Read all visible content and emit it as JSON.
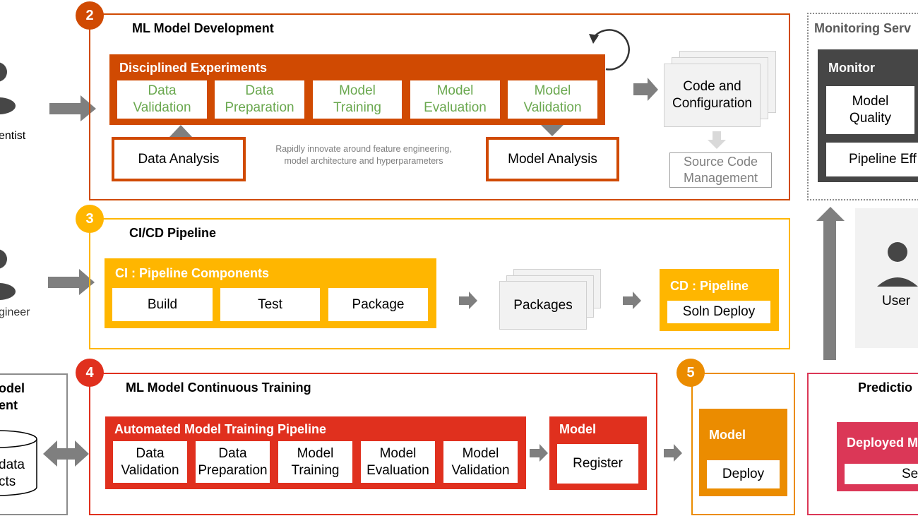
{
  "colors": {
    "dev": "#d04a02",
    "cicd": "#ffb600",
    "ct": "#e0301e",
    "deploy": "#eb8c00",
    "prediction": "#db3757",
    "monitor": "#464646",
    "arrow": "#7f7f7f",
    "green_text": "#6aa84f"
  },
  "left": {
    "data_scientist_label": "entist",
    "ml_engineer_label": "gineer",
    "model_mgmt_title_line1": "odel",
    "model_mgmt_title_line2": "ent",
    "cylinder_line1": "data",
    "cylinder_line2": "cts"
  },
  "dev": {
    "badge": "2",
    "title": "ML Model Development",
    "experiments_title": "Disciplined Experiments",
    "steps": [
      "Data\nValidation",
      "Data\nPreparation",
      "Model\nTraining",
      "Model\nEvaluation",
      "Model\nValidation"
    ],
    "data_analysis": "Data Analysis",
    "model_analysis": "Model Analysis",
    "caption": "Rapidly innovate  around feature engineering,\nmodel architecture and hyperparameters",
    "code_config": "Code and\nConfiguration",
    "scm": "Source Code\nManagement"
  },
  "monitoring": {
    "title": "Monitoring Serv",
    "monitor_title": "Monitor",
    "model_quality": "Model\nQuality",
    "pipeline_eff": "Pipeline  Eff",
    "user": "User"
  },
  "cicd": {
    "badge": "3",
    "title": "CI/CD Pipeline",
    "ci_title": "CI : Pipeline Components",
    "steps": [
      "Build",
      "Test",
      "Package"
    ],
    "packages": "Packages",
    "cd_title": "CD : Pipeline",
    "soln_deploy": "Soln Deploy"
  },
  "ct": {
    "badge": "4",
    "title": "ML Model Continuous Training",
    "pipeline_title": "Automated Model Training Pipeline",
    "steps": [
      "Data\nValidation",
      "Data\nPreparation",
      "Model\nTraining",
      "Model\nEvaluation",
      "Model\nValidation"
    ],
    "model_title": "Model",
    "register": "Register"
  },
  "deploy": {
    "badge": "5",
    "model_title": "Model",
    "deploy": "Deploy"
  },
  "prediction": {
    "title": "Predictio",
    "deployed_title": "Deployed M",
    "serve": "Se"
  }
}
